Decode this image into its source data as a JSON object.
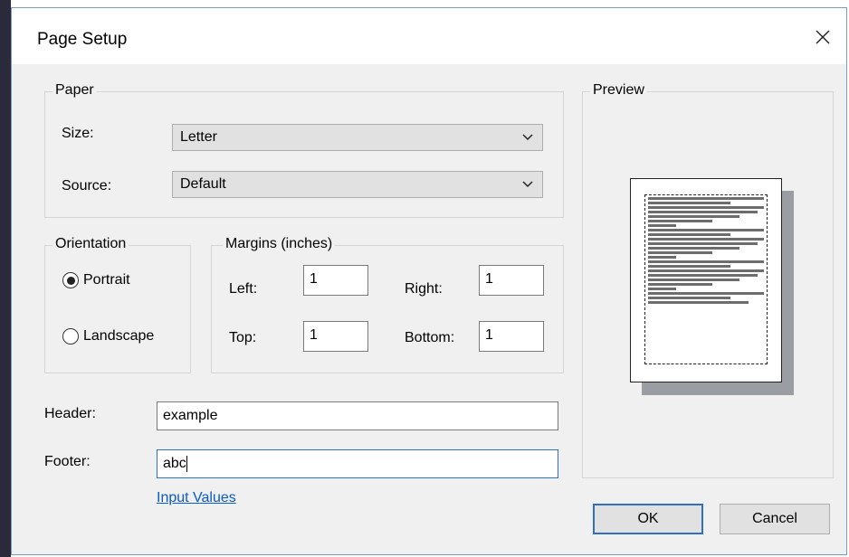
{
  "dialog": {
    "title": "Page Setup"
  },
  "paper": {
    "legend": "Paper",
    "size_label": "Size:",
    "size_value": "Letter",
    "source_label": "Source:",
    "source_value": "Default"
  },
  "orientation": {
    "legend": "Orientation",
    "portrait_label": "Portrait",
    "landscape_label": "Landscape",
    "selected": "Portrait"
  },
  "margins": {
    "legend": "Margins (inches)",
    "left_label": "Left:",
    "left_value": "1",
    "right_label": "Right:",
    "right_value": "1",
    "top_label": "Top:",
    "top_value": "1",
    "bottom_label": "Bottom:",
    "bottom_value": "1"
  },
  "header": {
    "label": "Header:",
    "value": "example"
  },
  "footer": {
    "label": "Footer:",
    "value": "abc"
  },
  "link": {
    "input_values": "Input Values"
  },
  "preview": {
    "legend": "Preview"
  },
  "buttons": {
    "ok": "OK",
    "cancel": "Cancel"
  },
  "colors": {
    "accent": "#2f6fc4",
    "link": "#0a5bc4",
    "dialog_bg": "#f0f0f0"
  }
}
